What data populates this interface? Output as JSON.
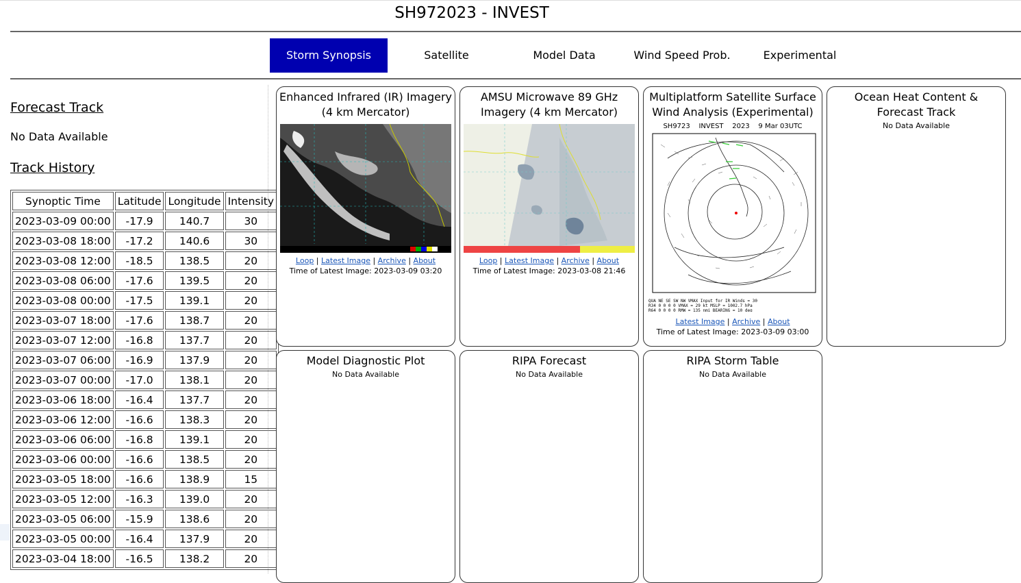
{
  "page": {
    "title": "SH972023 - INVEST"
  },
  "nav": {
    "tabs": [
      {
        "label": "Storm Synopsis"
      },
      {
        "label": "Satellite"
      },
      {
        "label": "Model Data"
      },
      {
        "label": "Wind Speed Prob."
      },
      {
        "label": "Experimental"
      }
    ],
    "active_color": "#0000b0"
  },
  "sidebar": {
    "forecast_heading": "Forecast Track",
    "forecast_nodata": "No Data Available",
    "history_heading": "Track History",
    "columns": [
      "Synoptic Time",
      "Latitude",
      "Longitude",
      "Intensity"
    ],
    "rows": [
      [
        "2023-03-09 00:00",
        "-17.9",
        "140.7",
        "30"
      ],
      [
        "2023-03-08 18:00",
        "-17.2",
        "140.6",
        "30"
      ],
      [
        "2023-03-08 12:00",
        "-18.5",
        "138.5",
        "20"
      ],
      [
        "2023-03-08 06:00",
        "-17.6",
        "139.5",
        "20"
      ],
      [
        "2023-03-08 00:00",
        "-17.5",
        "139.1",
        "20"
      ],
      [
        "2023-03-07 18:00",
        "-17.6",
        "138.7",
        "20"
      ],
      [
        "2023-03-07 12:00",
        "-16.8",
        "137.7",
        "20"
      ],
      [
        "2023-03-07 06:00",
        "-16.9",
        "137.9",
        "20"
      ],
      [
        "2023-03-07 00:00",
        "-17.0",
        "138.1",
        "20"
      ],
      [
        "2023-03-06 18:00",
        "-16.4",
        "137.7",
        "20"
      ],
      [
        "2023-03-06 12:00",
        "-16.6",
        "138.3",
        "20"
      ],
      [
        "2023-03-06 06:00",
        "-16.8",
        "139.1",
        "20"
      ],
      [
        "2023-03-06 00:00",
        "-16.6",
        "138.5",
        "20"
      ],
      [
        "2023-03-05 18:00",
        "-16.6",
        "138.9",
        "15"
      ],
      [
        "2023-03-05 12:00",
        "-16.3",
        "139.0",
        "20"
      ],
      [
        "2023-03-05 06:00",
        "-15.9",
        "138.6",
        "20"
      ],
      [
        "2023-03-05 00:00",
        "-16.4",
        "137.9",
        "20"
      ],
      [
        "2023-03-04 18:00",
        "-16.5",
        "138.2",
        "20"
      ]
    ]
  },
  "cards": {
    "ir": {
      "title": "Enhanced Infrared (IR) Imagery (4 km Mercator)",
      "link_loop": "Loop",
      "link_latest": "Latest Image",
      "link_archive": "Archive",
      "link_about": "About",
      "time": "Time of Latest Image: 2023-03-09 03:20",
      "image_icon": "ir-satellite-image"
    },
    "amsu": {
      "title": "AMSU Microwave 89 GHz Imagery (4 km Mercator)",
      "link_loop": "Loop",
      "link_latest": "Latest Image",
      "link_archive": "Archive",
      "link_about": "About",
      "time": "Time of Latest Image: 2023-03-08 21:46",
      "image_icon": "microwave-satellite-image"
    },
    "wind": {
      "title": "Multiplatform Satellite Surface Wind Analysis (Experimental)",
      "map_header": "SH9723    INVEST    2023    9 Mar 03UTC",
      "link_latest": "Latest Image",
      "link_archive": "Archive",
      "link_about": "About",
      "time": "Time of Latest Image: 2023-03-09 03:00",
      "image_icon": "wind-analysis-image"
    },
    "ohc": {
      "title": "Ocean Heat Content & Forecast Track",
      "nodata": "No Data Available"
    },
    "diag": {
      "title": "Model Diagnostic Plot",
      "nodata": "No Data Available"
    },
    "ripa": {
      "title": "RIPA Forecast",
      "nodata": "No Data Available"
    },
    "ripa_table": {
      "title": "RIPA Storm Table",
      "nodata": "No Data Available"
    }
  }
}
